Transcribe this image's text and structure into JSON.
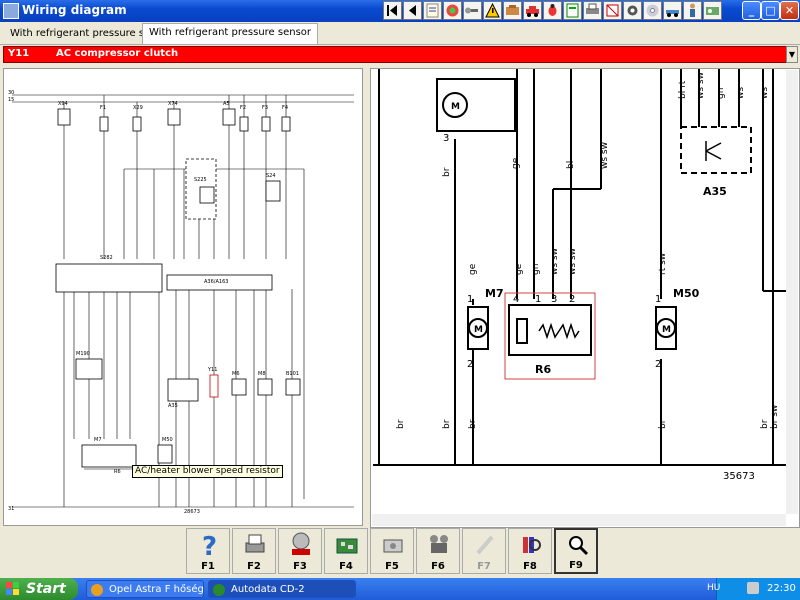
{
  "window": {
    "title": "Wiring diagram"
  },
  "toolbar_icons": [
    "first-page-icon",
    "prev-page-icon",
    "note-icon",
    "paint-icon",
    "tools-icon",
    "warning-icon",
    "engine-icon",
    "car-icon",
    "bug-icon",
    "doc-icon",
    "printer-icon",
    "tag-icon",
    "gear-icon",
    "cd-icon",
    "car-side-icon",
    "man-icon",
    "settings-icon"
  ],
  "tabs": [
    {
      "label": "With refrigerant pressure switch"
    },
    {
      "label": "With refrigerant pressure sensor"
    }
  ],
  "component": {
    "code": "Y11",
    "name": "AC compressor clutch"
  },
  "left_diagram": {
    "labels": {
      "x94": "X94",
      "x29": "X29",
      "x74": "X74",
      "a5": "A5",
      "f1": "F1",
      "f2": "F2",
      "f3": "F3",
      "f4": "F4",
      "s282": "S282",
      "s226": "S226",
      "s24": "S24",
      "s225": "S225",
      "a35": "A35",
      "m7": "M7",
      "m50": "M50",
      "r6": "R6",
      "y11": "Y11",
      "a36": "A36/A163",
      "b101": "B101",
      "m190": "M190",
      "m6": "M6",
      "m8": "M8",
      "m40": "M40",
      "r30": "30",
      "r15": "15",
      "r31": "31",
      "foot": "28673"
    },
    "tooltip": "AC/heater blower speed resistor"
  },
  "right_diagram": {
    "wires_top": [
      "ge",
      "bl",
      "ws sw",
      "bl rt",
      "ws sw",
      "gn",
      "ws",
      "ws"
    ],
    "wires_mid": [
      "br",
      "ge",
      "ge",
      "gn",
      "ws sw",
      "ws sw",
      "rt sw"
    ],
    "wires_low": [
      "br",
      "br",
      "br",
      "br",
      "br",
      "br sw"
    ],
    "components": {
      "m7": "M7",
      "r6": "R6",
      "m50": "M50",
      "a35": "A35"
    },
    "pins_m7": [
      "1",
      "2"
    ],
    "pins_r6": [
      "4",
      "1",
      "3",
      "2"
    ],
    "pins_m50": [
      "1",
      "2"
    ],
    "pins_top": [
      "3"
    ],
    "ref": "35673"
  },
  "fkeys": [
    {
      "label": "F1",
      "icon": "help-icon"
    },
    {
      "label": "F2",
      "icon": "print-icon"
    },
    {
      "label": "F3",
      "icon": "ac-icon"
    },
    {
      "label": "F4",
      "icon": "circuit-board-icon"
    },
    {
      "label": "F5",
      "icon": "component-icon"
    },
    {
      "label": "F6",
      "icon": "connector-icon"
    },
    {
      "label": "F7",
      "icon": "disabled-tool-icon"
    },
    {
      "label": "F8",
      "icon": "color-code-icon"
    },
    {
      "label": "F9",
      "icon": "zoom-icon"
    }
  ],
  "taskbar": {
    "start": "Start",
    "tasks": [
      "Opel Astra F hőségbe...",
      "Autodata CD-2"
    ],
    "lang": "HU",
    "time": "22:30"
  },
  "colors": {
    "accent_red": "#ff0000",
    "title_blue": "#0a4ad0",
    "taskbar_blue": "#1f5cd8",
    "tooltip": "#ffffe1"
  }
}
